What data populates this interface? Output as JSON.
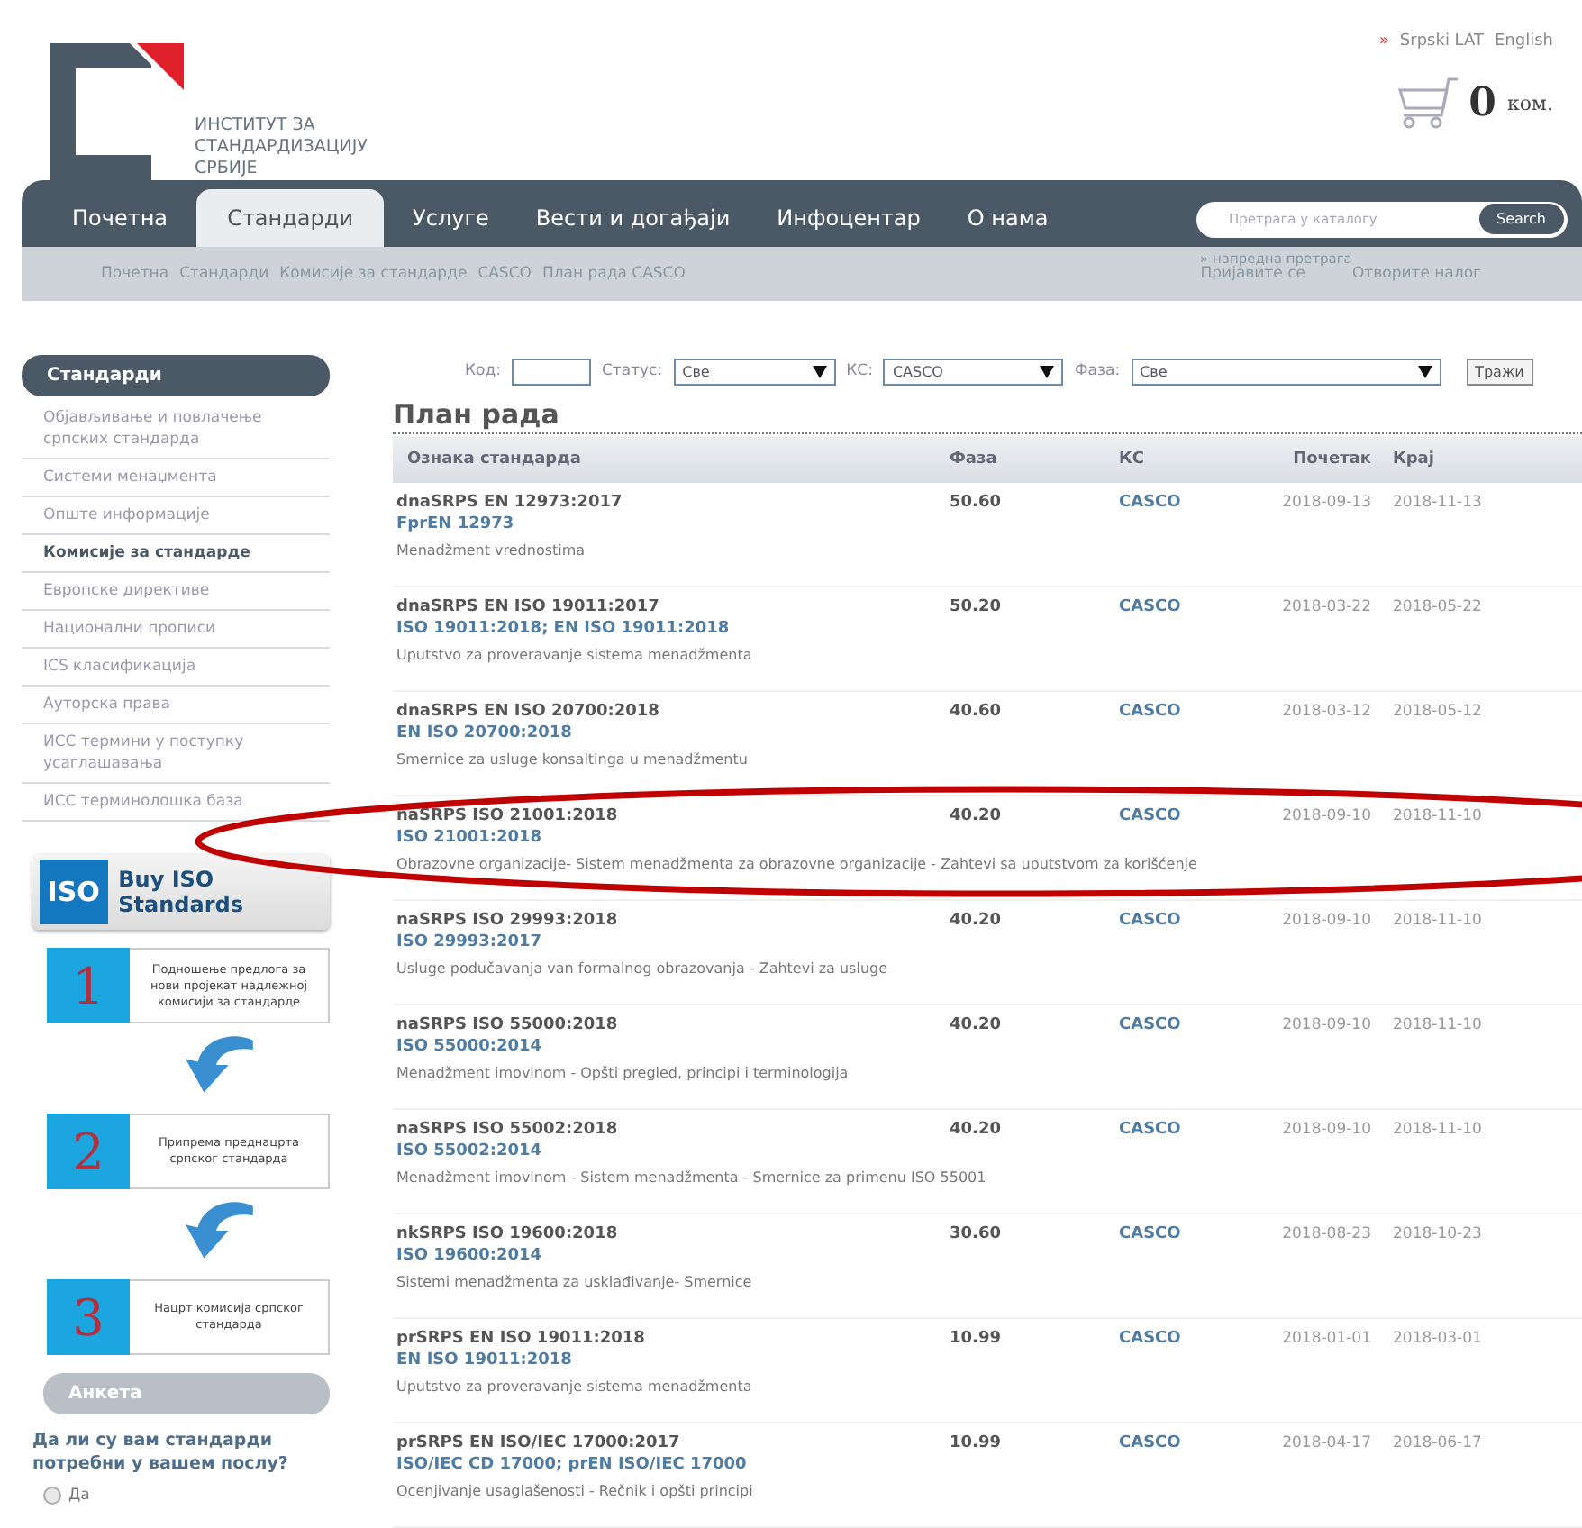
{
  "header": {
    "logo_lines": [
      "ИНСТИТУТ ЗА",
      "СТАНДАРДИЗАЦИЈУ",
      "СРБИЈЕ"
    ],
    "languages": [
      {
        "label": "Srpski LAT",
        "marker": "»"
      },
      {
        "label": "English"
      }
    ],
    "cart": {
      "count": "0",
      "unit": "ком."
    }
  },
  "nav": {
    "tabs": [
      {
        "label": "Почетна",
        "selected": false
      },
      {
        "label": "Стандарди",
        "selected": true
      },
      {
        "label": "Услуге",
        "selected": false
      },
      {
        "label": "Вести и догађаји",
        "selected": false
      },
      {
        "label": "Инфоцентар",
        "selected": false
      },
      {
        "label": "О нама",
        "selected": false
      }
    ],
    "search": {
      "placeholder": "Претрага у каталогу",
      "button": "Search",
      "advanced": "» напредна претрага"
    }
  },
  "breadcrumb": [
    "Почетна",
    "Стандарди",
    "Комисије за стандарде",
    "CASCO",
    "План рада CASCO"
  ],
  "account_links": [
    "Пријавите се",
    "Отворите налог"
  ],
  "sidebar": {
    "title": "Стандарди",
    "items": [
      {
        "label": "Објављивање и повлачење српских стандарда",
        "selected": false
      },
      {
        "label": "Системи менаџмента",
        "selected": false
      },
      {
        "label": "Опште информације",
        "selected": false
      },
      {
        "label": "Комисије за стандарде",
        "selected": true
      },
      {
        "label": "Европске директиве",
        "selected": false
      },
      {
        "label": "Национални прописи",
        "selected": false
      },
      {
        "label": "ICS класификација",
        "selected": false
      },
      {
        "label": "Ауторска права",
        "selected": false
      },
      {
        "label": "ИСС термини у поступку усаглашавања",
        "selected": false
      },
      {
        "label": "ИСС терминолошка база",
        "selected": false
      }
    ]
  },
  "iso_banner": {
    "badge": "ISO",
    "label": "Buy ISO Standards"
  },
  "steps": [
    {
      "number": "1",
      "text": "Подношење предлога за нови пројекат надлежној комисији за стандарде"
    },
    {
      "number": "2",
      "text": "Припрема преднацрта српског стандарда"
    },
    {
      "number": "3",
      "text": "Нацрт комисија српског стандарда"
    }
  ],
  "poll": {
    "title": "Анкета",
    "question": "Да ли су вам стандарди потребни у вашем послу?",
    "options": [
      {
        "label": "Да",
        "selected": false
      }
    ]
  },
  "filters": {
    "code": {
      "label": "Код:"
    },
    "status": {
      "label": "Статус:",
      "value": "Све"
    },
    "ks": {
      "label": "КС:",
      "value": "CASCO"
    },
    "phase": {
      "label": "Фаза:",
      "value": "Све"
    },
    "button": "Тражи"
  },
  "page_title": "План рада",
  "table": {
    "columns": [
      "Ознака стандарда",
      "Фаза",
      "КС",
      "Почетак",
      "Крај"
    ],
    "rows": [
      {
        "code": "dnaSRPS EN 12973:2017",
        "reference": "FprEN 12973",
        "description": "Menadžment vrednostima",
        "phase": "50.60",
        "ks": "CASCO",
        "start": "2018-09-13",
        "end": "2018-11-13"
      },
      {
        "code": "dnaSRPS EN ISO 19011:2017",
        "reference": "ISO 19011:2018; EN ISO 19011:2018",
        "description": "Uputstvo za proveravanje sistema menadžmenta",
        "phase": "50.20",
        "ks": "CASCO",
        "start": "2018-03-22",
        "end": "2018-05-22"
      },
      {
        "code": "dnaSRPS EN ISO 20700:2018",
        "reference": "EN ISO 20700:2018",
        "description": "Smernice za usluge konsaltinga u menadžmentu",
        "phase": "40.60",
        "ks": "CASCO",
        "start": "2018-03-12",
        "end": "2018-05-12"
      },
      {
        "code": "naSRPS ISO 21001:2018",
        "reference": "ISO 21001:2018",
        "description": "Obrazovne organizacije- Sistem menadžmenta za obrazovne organizacije - Zahtevi sa uputstvom za korišćenje",
        "phase": "40.20",
        "ks": "CASCO",
        "start": "2018-09-10",
        "end": "2018-11-10"
      },
      {
        "code": "naSRPS ISO 29993:2018",
        "reference": "ISO 29993:2017",
        "description": "Usluge podučavanja van formalnog obrazovanja - Zahtevi za usluge",
        "phase": "40.20",
        "ks": "CASCO",
        "start": "2018-09-10",
        "end": "2018-11-10"
      },
      {
        "code": "naSRPS ISO 55000:2018",
        "reference": "ISO 55000:2014",
        "description": "Menadžment imovinom - Opšti pregled, principi i terminologija",
        "phase": "40.20",
        "ks": "CASCO",
        "start": "2018-09-10",
        "end": "2018-11-10"
      },
      {
        "code": "naSRPS ISO 55002:2018",
        "reference": "ISO 55002:2014",
        "description": "Menadžment imovinom - Sistem menadžmenta - Smernice za primenu ISO 55001",
        "phase": "40.20",
        "ks": "CASCO",
        "start": "2018-09-10",
        "end": "2018-11-10"
      },
      {
        "code": "nkSRPS ISO 19600:2018",
        "reference": "ISO 19600:2014",
        "description": "Sistemi menadžmenta za usklađivanje- Smernice",
        "phase": "30.60",
        "ks": "CASCO",
        "start": "2018-08-23",
        "end": "2018-10-23"
      },
      {
        "code": "prSRPS EN ISO 19011:2018",
        "reference": "EN ISO 19011:2018",
        "description": "Uputstvo za proveravanje sistema menadžmenta",
        "phase": "10.99",
        "ks": "CASCO",
        "start": "2018-01-01",
        "end": "2018-03-01"
      },
      {
        "code": "prSRPS EN ISO/IEC 17000:2017",
        "reference": "ISO/IEC CD 17000; prEN ISO/IEC 17000",
        "description": "Ocenjivanje usaglašenosti - Rečnik i opšti principi",
        "phase": "10.99",
        "ks": "CASCO",
        "start": "2018-04-17",
        "end": "2018-06-17"
      }
    ]
  },
  "annotation": {
    "kind": "ellipse",
    "color": "#c00000"
  }
}
